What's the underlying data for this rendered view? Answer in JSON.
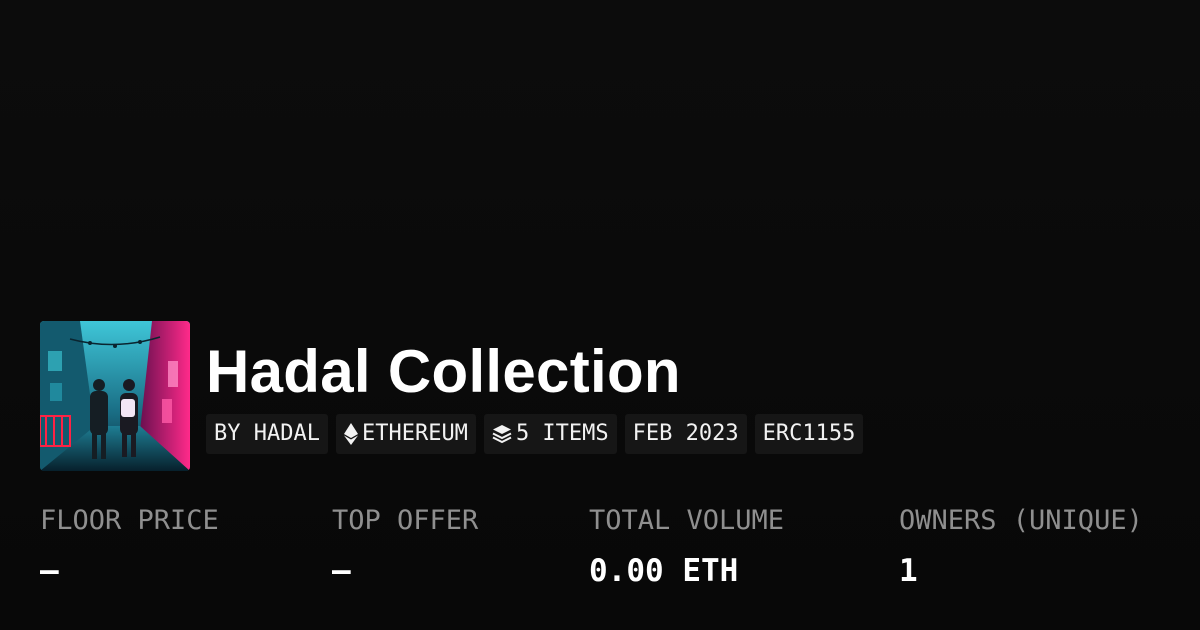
{
  "collection": {
    "title": "Hadal Collection",
    "image_alt": "Neon alley artwork",
    "tags": [
      {
        "label": "BY HADAL",
        "icon": ""
      },
      {
        "label": "ETHEREUM",
        "icon": "ethereum-icon"
      },
      {
        "label": "5 ITEMS",
        "icon": "layers-icon"
      },
      {
        "label": "FEB 2023",
        "icon": ""
      },
      {
        "label": "ERC1155",
        "icon": ""
      }
    ]
  },
  "stats": [
    {
      "label": "FLOOR PRICE",
      "value": "—"
    },
    {
      "label": "TOP OFFER",
      "value": "—"
    },
    {
      "label": "TOTAL VOLUME",
      "value": "0.00 ETH"
    },
    {
      "label": "OWNERS (UNIQUE)",
      "value": "1"
    }
  ],
  "colors": {
    "background": "#0b0b0b",
    "tag_background": "#161616",
    "label_gray": "#8f8f8f",
    "neon_pink": "#ff2a8a",
    "neon_cyan": "#27d3e0"
  }
}
